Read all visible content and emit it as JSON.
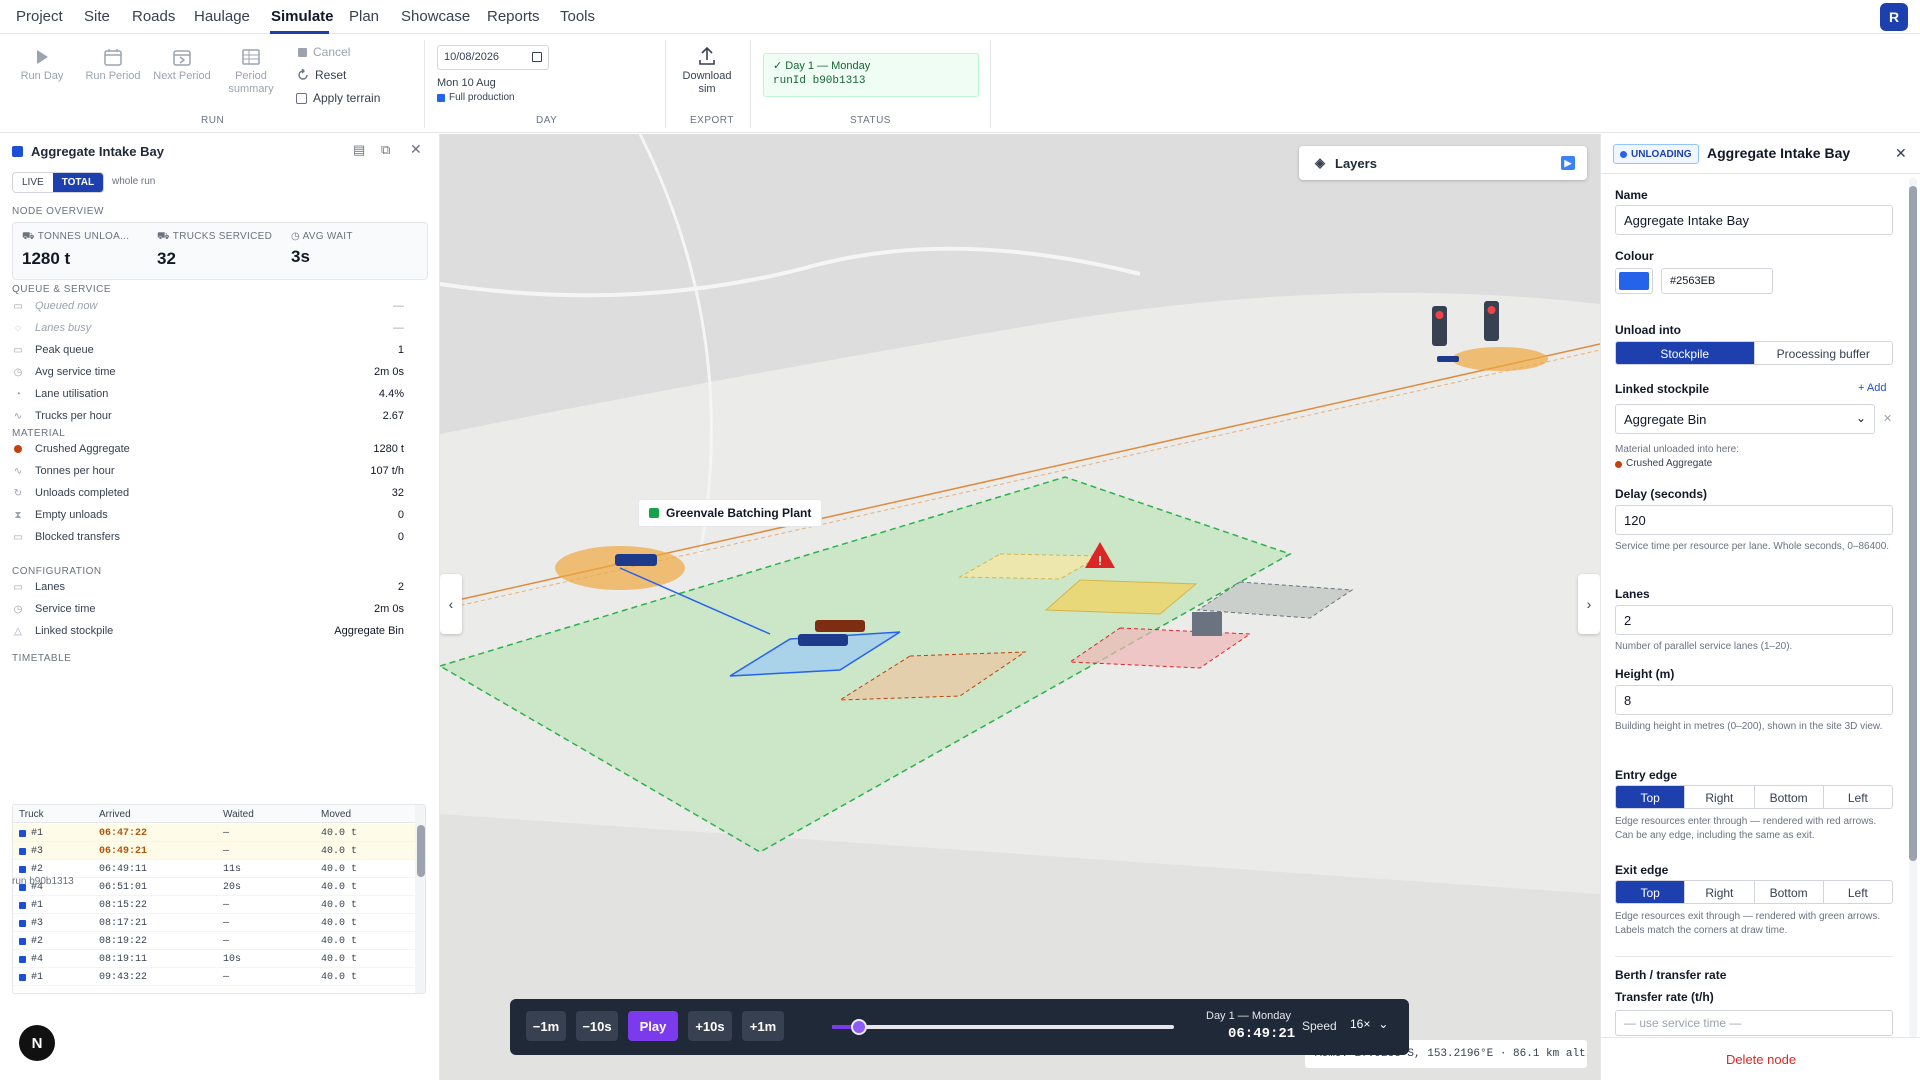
{
  "menu": {
    "items": [
      "Project",
      "Site",
      "Roads",
      "Haulage",
      "Simulate",
      "Plan",
      "Showcase",
      "Reports",
      "Tools"
    ],
    "active": "Simulate",
    "avatar": "R"
  },
  "ribbon": {
    "run_day": "Run Day",
    "run_period": "Run Period",
    "next_period": "Next Period",
    "period_summary_1": "Period",
    "period_summary_2": "summary",
    "cancel": "Cancel",
    "reset": "Reset",
    "apply_terrain": "Apply terrain",
    "date_value": "10/08/2026",
    "date_text": "Mon 10 Aug",
    "production": "Full production",
    "download_1": "Download",
    "download_2": "sim",
    "status_line1": "✓ Day 1 — Monday",
    "status_line2": "runId b90b1313",
    "groups": {
      "run": "RUN",
      "day": "DAY",
      "export": "EXPORT",
      "status": "STATUS"
    }
  },
  "left": {
    "title": "Aggregate Intake Bay",
    "tabs": {
      "live": "LIVE",
      "total": "TOTAL",
      "whole": "whole run"
    },
    "sections": {
      "overview": "NODE OVERVIEW",
      "queue": "QUEUE & SERVICE",
      "material": "MATERIAL",
      "config": "CONFIGURATION",
      "timetable": "TIMETABLE"
    },
    "kpis": [
      {
        "label": "TONNES UNLOA...",
        "value": "1280 t"
      },
      {
        "label": "TRUCKS SERVICED",
        "value": "32"
      },
      {
        "label": "AVG WAIT",
        "value": "3s"
      }
    ],
    "queue": [
      {
        "label": "Queued now",
        "value": "—",
        "muted": true
      },
      {
        "label": "Lanes busy",
        "value": "—",
        "muted": true
      },
      {
        "label": "Peak queue",
        "value": "1"
      },
      {
        "label": "Avg service time",
        "value": "2m 0s"
      },
      {
        "label": "Lane utilisation",
        "value": "4.4%"
      },
      {
        "label": "Trucks per hour",
        "value": "2.67"
      }
    ],
    "material": [
      {
        "label": "Crushed Aggregate",
        "value": "1280 t"
      },
      {
        "label": "Tonnes per hour",
        "value": "107 t/h"
      },
      {
        "label": "Unloads completed",
        "value": "32"
      },
      {
        "label": "Empty unloads",
        "value": "0"
      },
      {
        "label": "Blocked transfers",
        "value": "0"
      }
    ],
    "config": [
      {
        "label": "Lanes",
        "value": "2"
      },
      {
        "label": "Service time",
        "value": "2m 0s"
      },
      {
        "label": "Linked stockpile",
        "value": "Aggregate Bin"
      }
    ],
    "table": {
      "headers": [
        "Truck",
        "Arrived",
        "Waited",
        "Moved"
      ],
      "rows": [
        {
          "truck": "#1",
          "arrived": "06:47:22",
          "waited": "—",
          "moved": "40.0 t",
          "hl": true
        },
        {
          "truck": "#3",
          "arrived": "06:49:21",
          "waited": "—",
          "moved": "40.0 t",
          "hl": true
        },
        {
          "truck": "#2",
          "arrived": "06:49:11",
          "waited": "11s",
          "moved": "40.0 t"
        },
        {
          "truck": "#4",
          "arrived": "06:51:01",
          "waited": "20s",
          "moved": "40.0 t"
        },
        {
          "truck": "#1",
          "arrived": "08:15:22",
          "waited": "—",
          "moved": "40.0 t"
        },
        {
          "truck": "#3",
          "arrived": "08:17:21",
          "waited": "—",
          "moved": "40.0 t"
        },
        {
          "truck": "#2",
          "arrived": "08:19:22",
          "waited": "—",
          "moved": "40.0 t"
        },
        {
          "truck": "#4",
          "arrived": "08:19:11",
          "waited": "10s",
          "moved": "40.0 t"
        },
        {
          "truck": "#1",
          "arrived": "09:43:22",
          "waited": "—",
          "moved": "40.0 t"
        }
      ]
    },
    "run_id": "run b90b1313"
  },
  "map": {
    "layers": "Layers",
    "plant_label": "Greenvale Batching Plant",
    "coords": "Acme: 27.9258°S, 153.2196°E · 86.1 km alt"
  },
  "player": {
    "minus1m": "−1m",
    "minus10s": "−10s",
    "play": "Play",
    "plus10s": "+10s",
    "plus1m": "+1m",
    "progress": 0.08,
    "day": "Day 1 — Monday",
    "time": "06:49:21",
    "speed_label": "Speed",
    "speed": "16×"
  },
  "right": {
    "badge": "UNLOADING",
    "title": "Aggregate Intake Bay",
    "name_label": "Name",
    "name": "Aggregate Intake Bay",
    "colour_label": "Colour",
    "colour": "#2563EB",
    "unload_label": "Unload into",
    "unload_options": [
      "Stockpile",
      "Processing buffer"
    ],
    "linked_label": "Linked stockpile",
    "add": "+ Add",
    "linked": "Aggregate Bin",
    "material_note": "Material unloaded into here:",
    "material": "Crushed Aggregate",
    "delay_label": "Delay (seconds)",
    "delay": "120",
    "delay_help": "Service time per resource per lane. Whole seconds, 0–86400.",
    "lanes_label": "Lanes",
    "lanes": "2",
    "lanes_help": "Number of parallel service lanes (1–20).",
    "height_label": "Height (m)",
    "height": "8",
    "height_help": "Building height in metres (0–200), shown in the site 3D view.",
    "entry_label": "Entry edge",
    "edges": [
      "Top",
      "Right",
      "Bottom",
      "Left"
    ],
    "entry_help": "Edge resources enter through — rendered with red arrows. Can be any edge, including the same as exit.",
    "exit_label": "Exit edge",
    "exit_help": "Edge resources exit through — rendered with green arrows. Labels match the corners at draw time.",
    "berth_label": "Berth / transfer rate",
    "transfer_label": "Transfer rate (t/h)",
    "transfer_placeholder": "— use service time —",
    "delete": "Delete node"
  },
  "colors": {
    "accent": "#1e40af",
    "node": "#2563EB",
    "play": "#7c3aed",
    "material": "#c2410c"
  }
}
